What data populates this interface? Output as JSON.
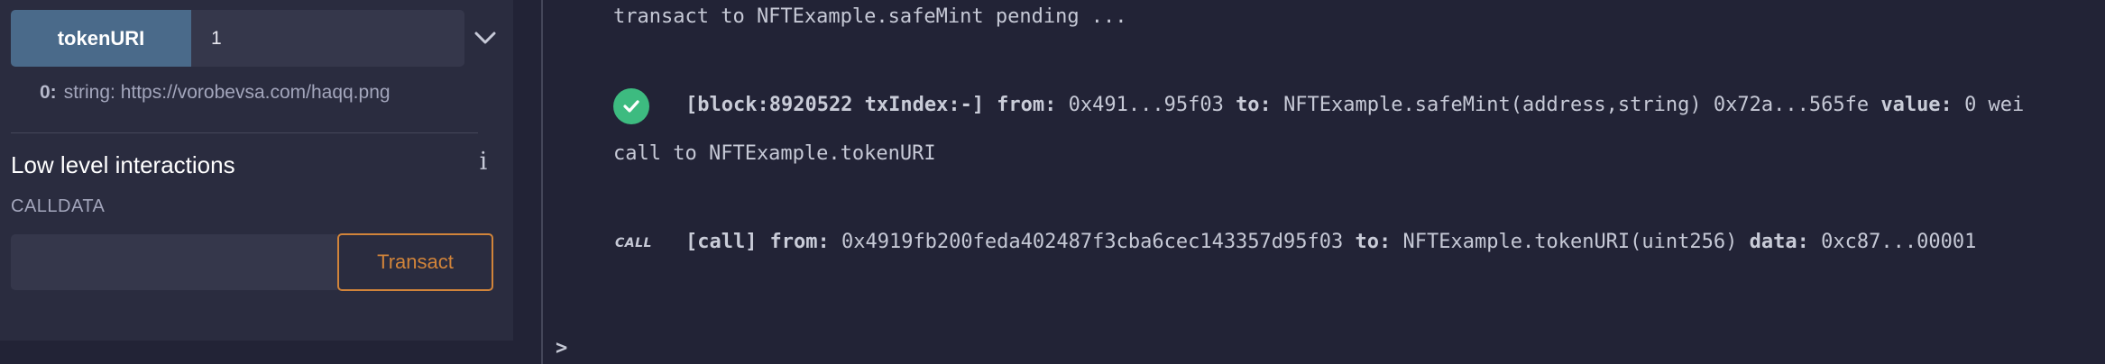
{
  "left": {
    "function_button": "tokenURI",
    "function_input_value": "1",
    "expand_icon": "chevron-down-icon",
    "result": {
      "key": "0:",
      "value": "string: https://vorobevsa.com/haqq.png"
    },
    "low_level": {
      "title": "Low level interactions",
      "info_icon": "info-icon",
      "info_glyph": "i",
      "calldata_label": "CALLDATA",
      "calldata_value": "",
      "transact_label": "Transact"
    }
  },
  "terminal": {
    "pending_line": "transact to NFTExample.safeMint pending ...",
    "tx": {
      "status_icon": "check-circle-icon",
      "block": "[block:8920522 txIndex:-]",
      "from_label": "from:",
      "from": "0x491...95f03",
      "to_label": "to:",
      "to": "NFTExample.safeMint(address,string) 0x72a...565fe",
      "value_label": "value:",
      "value": "0 wei"
    },
    "call_line": "call to NFTExample.tokenURI",
    "call": {
      "tag": "CALL",
      "block": "[call]",
      "from_label": "from:",
      "from": "0x4919fb200feda402487f3cba6cec143357d95f03",
      "to_label": "to:",
      "to": "NFTExample.tokenURI(uint256)",
      "data_label": "data:",
      "data": "0xc87...00001"
    },
    "prompt": ">"
  },
  "colors": {
    "accent_orange": "#d1843a",
    "button_blue": "#4a6a8a",
    "success_green": "#3dbb80",
    "background": "#222336",
    "panel": "#2a2c3f"
  }
}
